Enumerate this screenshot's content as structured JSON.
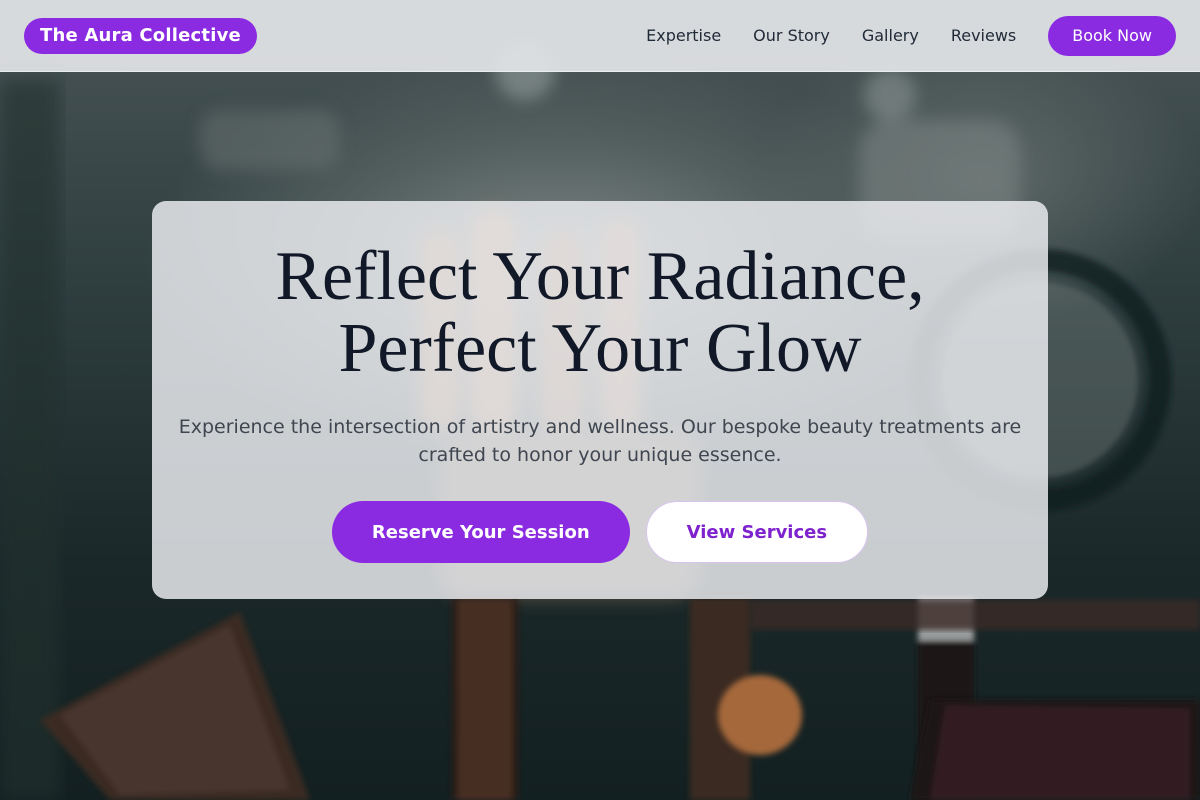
{
  "brand": {
    "name": "The Aura Collective"
  },
  "nav": {
    "links": [
      "Expertise",
      "Our Story",
      "Gallery",
      "Reviews"
    ],
    "cta_label": "Book Now"
  },
  "hero": {
    "title_line1": "Reflect Your Radiance,",
    "title_line2": "Perfect Your Glow",
    "subtitle": "Experience the intersection of artistry and wellness. Our bespoke beauty treatments are crafted to honor your unique essence.",
    "primary_cta": "Reserve Your Session",
    "secondary_cta": "View Services"
  },
  "colors": {
    "accent": "#8a2be2",
    "accent_text": "#7e22ce",
    "heading": "#111827",
    "body_text": "#3f4650"
  },
  "background": {
    "image_subject": "blurred-makeup-vanity-photo"
  }
}
